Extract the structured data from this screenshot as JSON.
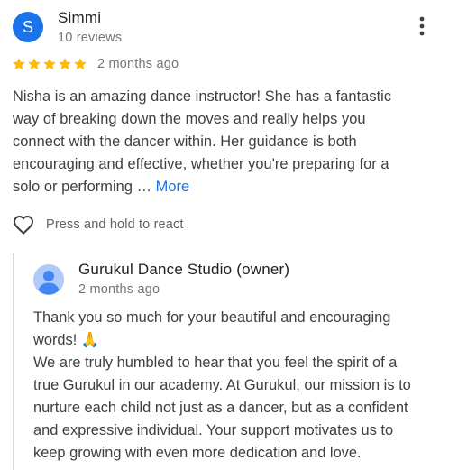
{
  "review": {
    "reviewer": {
      "initial": "S",
      "name": "Simmi",
      "meta": "10 reviews",
      "avatar_color": "#1a73e8"
    },
    "rating": 5,
    "star_color": "#fbbc04",
    "date": "2 months ago",
    "text_lines": [
      "Nisha is an amazing dance instructor! She has a fantastic",
      "way of breaking down the moves and really helps you",
      "connect with the dancer within. Her guidance is both",
      "encouraging and effective, whether you're preparing for a",
      "solo or performing … "
    ],
    "more_label": "More",
    "react_label": "Press and hold to react",
    "menu_icon": "more-vert-icon",
    "heart_icon": "heart-outline-icon"
  },
  "owner_reply": {
    "name": "Gurukul Dance Studio (owner)",
    "date": "2 months ago",
    "text_lines": [
      "Thank you so much for your beautiful and encouraging",
      "words! 🙏",
      "We are truly humbled to hear that you feel the spirit of a",
      "true Gurukul in our academy. At Gurukul, our mission is to",
      "nurture each child not just as a dancer, but as a confident",
      "and expressive individual. Your support motivates us to",
      "keep growing with even more dedication and love."
    ],
    "avatar_icon": "default-person-avatar-icon"
  },
  "colors": {
    "accent": "#1a73e8",
    "text": "#3c4043",
    "secondary_text": "#70757a",
    "divider": "#dadce0"
  }
}
